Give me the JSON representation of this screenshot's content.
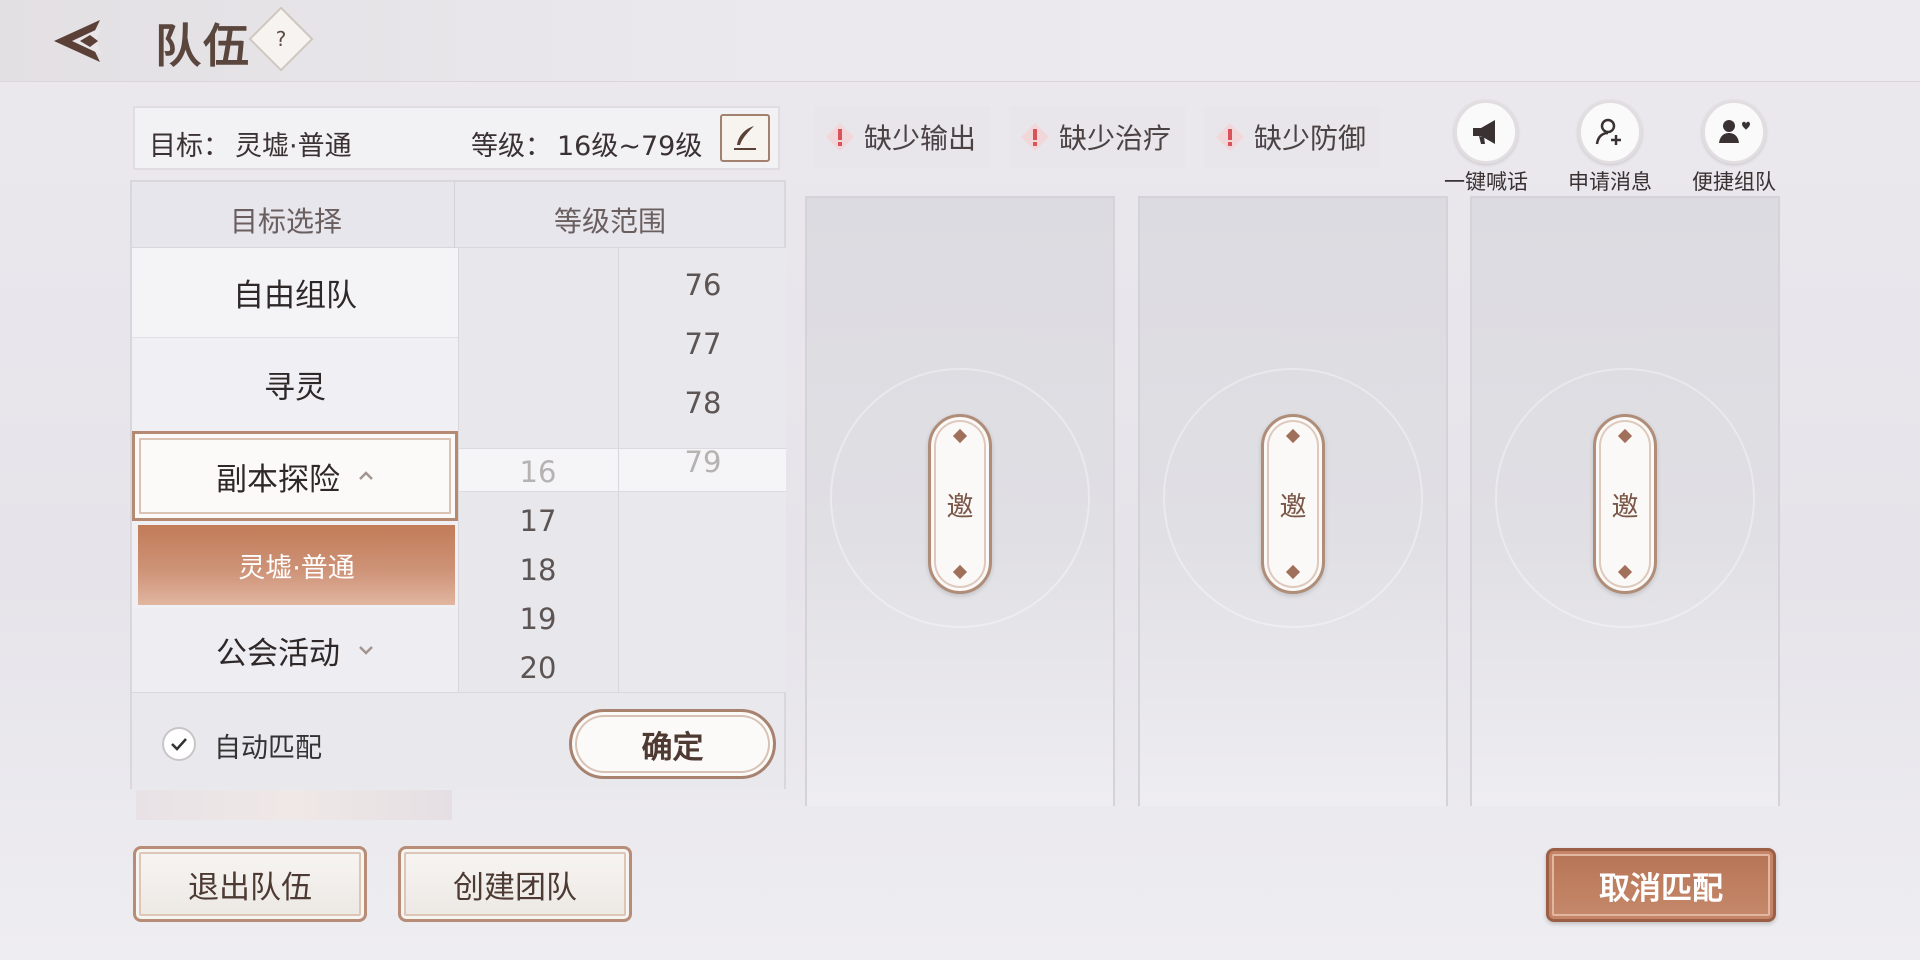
{
  "header": {
    "title": "队伍",
    "help_label": "?"
  },
  "target_bar": {
    "target_label": "目标：",
    "target_value": "灵墟·普通",
    "level_label": "等级：",
    "level_value": "16级~79级"
  },
  "panel": {
    "header_target": "目标选择",
    "header_level": "等级范围",
    "items": [
      {
        "label": "自由组队",
        "state": "normal"
      },
      {
        "label": "寻灵",
        "state": "normal"
      },
      {
        "label": "副本探险",
        "state": "expanded"
      },
      {
        "label": "灵墟·普通",
        "state": "selected-sub"
      },
      {
        "label": "公会活动",
        "state": "collapsed"
      }
    ],
    "min_levels": [
      "16",
      "17",
      "18",
      "19",
      "20"
    ],
    "max_levels": [
      "76",
      "77",
      "78",
      "79"
    ],
    "auto_match_label": "自动匹配",
    "auto_match_checked": true,
    "confirm_label": "确定"
  },
  "lack_tags": [
    {
      "label": "缺少输出"
    },
    {
      "label": "缺少治疗"
    },
    {
      "label": "缺少防御"
    }
  ],
  "quick_actions": [
    {
      "label": "一键喊话",
      "icon": "megaphone-icon"
    },
    {
      "label": "申请消息",
      "icon": "user-add-icon"
    },
    {
      "label": "便捷组队",
      "icon": "group-heart-icon"
    }
  ],
  "slots": [
    {
      "invite_label": "邀"
    },
    {
      "invite_label": "邀"
    },
    {
      "invite_label": "邀"
    }
  ],
  "bottom": {
    "leave_label": "退出队伍",
    "create_label": "创建团队",
    "cancel_match_label": "取消匹配"
  },
  "colors": {
    "accent_copper": "#c27c58",
    "border_brown": "#b48a73",
    "warning_red": "#d9535a"
  }
}
